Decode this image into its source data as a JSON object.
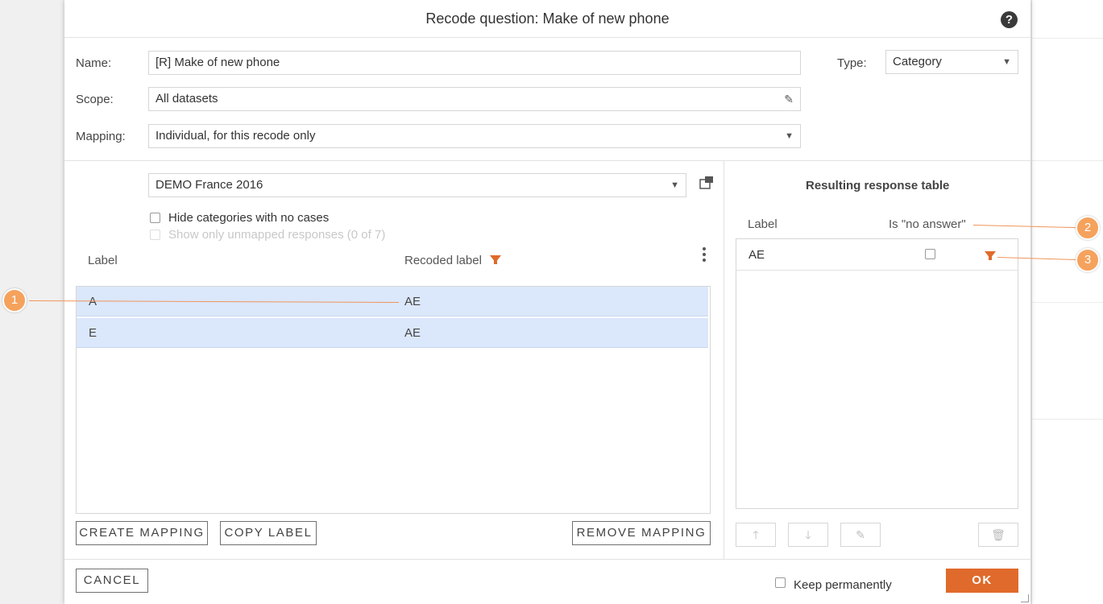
{
  "dialog": {
    "title": "Recode question: Make of new phone",
    "help_icon": "question-icon"
  },
  "form": {
    "name_label": "Name:",
    "name_value": "[R] Make of new phone",
    "scope_label": "Scope:",
    "scope_value": "All datasets",
    "mapping_label": "Mapping:",
    "mapping_value": "Individual, for this recode only",
    "type_label": "Type:",
    "type_value": "Category"
  },
  "left": {
    "dataset_value": "DEMO France 2016",
    "hide_empty_label": "Hide categories with no cases",
    "show_unmapped_label": "Show only unmapped responses (0 of 7)",
    "col_label": "Label",
    "col_recoded": "Recoded label",
    "rows": [
      {
        "label": "A",
        "recoded": "AE"
      },
      {
        "label": "E",
        "recoded": "AE"
      }
    ],
    "create_mapping": "CREATE MAPPING",
    "copy_label": "COPY LABEL",
    "remove_mapping": "REMOVE MAPPING"
  },
  "right": {
    "title": "Resulting response table",
    "col_label": "Label",
    "col_no_answer": "Is \"no answer\"",
    "rows": [
      {
        "label": "AE"
      }
    ]
  },
  "footer": {
    "cancel": "CANCEL",
    "keep_label": "Keep permanently",
    "ok": "OK"
  },
  "callouts": [
    "1",
    "2",
    "3"
  ],
  "colors": {
    "accent": "#e06a2b",
    "selected_row": "#dbe7fb",
    "callout": "#f5a25d"
  }
}
